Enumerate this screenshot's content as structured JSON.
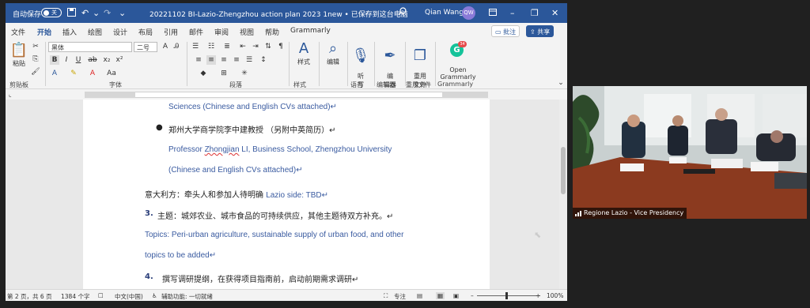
{
  "window": {
    "autosave_label": "自动保存",
    "autosave_state": "关",
    "title": "20221102 BI-Lazio-Zhengzhou action plan 2023 1new • 已保存到这台电脑",
    "title_caret": "⌄",
    "user_name": "Qian Wang",
    "user_initials": "QW"
  },
  "tabs": [
    "文件",
    "开始",
    "插入",
    "绘图",
    "设计",
    "布局",
    "引用",
    "邮件",
    "审阅",
    "视图",
    "帮助",
    "Grammarly"
  ],
  "active_tab_index": 1,
  "tab_buttons": {
    "comments": "批注",
    "share": "共享"
  },
  "ribbon": {
    "font_name": "黑体",
    "font_size": "二号",
    "paste_label": "粘贴",
    "groups": {
      "clipboard": "剪贴板",
      "font": "字体",
      "paragraph": "段落",
      "styles": "样式",
      "voice": "语音",
      "editor": "编辑器",
      "reuse": "重用文件",
      "grammarly": "Grammarly"
    },
    "big_buttons": {
      "styles": "样式",
      "editing": "编辑",
      "dictate": "听\n写",
      "editor": "编\n辑器",
      "reuse": "重用\n文件",
      "grammarly": "Open\nGrammarly"
    },
    "grammarly_badge": "34"
  },
  "document": {
    "lines": [
      {
        "text": "Sciences (Chinese and English CVs attached)↵",
        "style": "blue"
      },
      {
        "bullet": "●",
        "text": "郑州大学商学院李中建教授 （另附中英简历）↵",
        "style": "cn"
      },
      {
        "text_a": "Professor ",
        "text_b": "Zhongjian",
        "text_c": " LI, Business School, Zhengzhou University",
        "style": "blue"
      },
      {
        "text": "(Chinese and English CVs attached)↵",
        "style": "blue"
      },
      {
        "text_cn": "意大利方：牵头人和参加人待明确 ",
        "text_en": "Lazio side: TBD↵"
      },
      {
        "num": "3.",
        "text": "主题：城郊农业、城市食品的可持续供应，其他主题待双方补充。↵",
        "style": "cn"
      },
      {
        "text": "Topics: Peri-urban agriculture, sustainable supply of urban food, and other",
        "style": "blue"
      },
      {
        "text": "topics to be added↵",
        "style": "blue"
      },
      {
        "num": "4.",
        "text": "撰写调研提纲，在获得项目指南前，启动前期需求调研↵",
        "style": "cn"
      }
    ]
  },
  "status": {
    "page": "第 2 页，共 6 页",
    "words": "1384 个字",
    "language": "中文(中国)",
    "accessibility": "辅助功能: 一切就绪",
    "focus": "专注",
    "zoom": "100%"
  },
  "video": {
    "participant_label": "Regione Lazio - Vice Presidency"
  },
  "colors": {
    "titlebar": "#2b579a",
    "doc_blue": "#3a5ba0"
  }
}
